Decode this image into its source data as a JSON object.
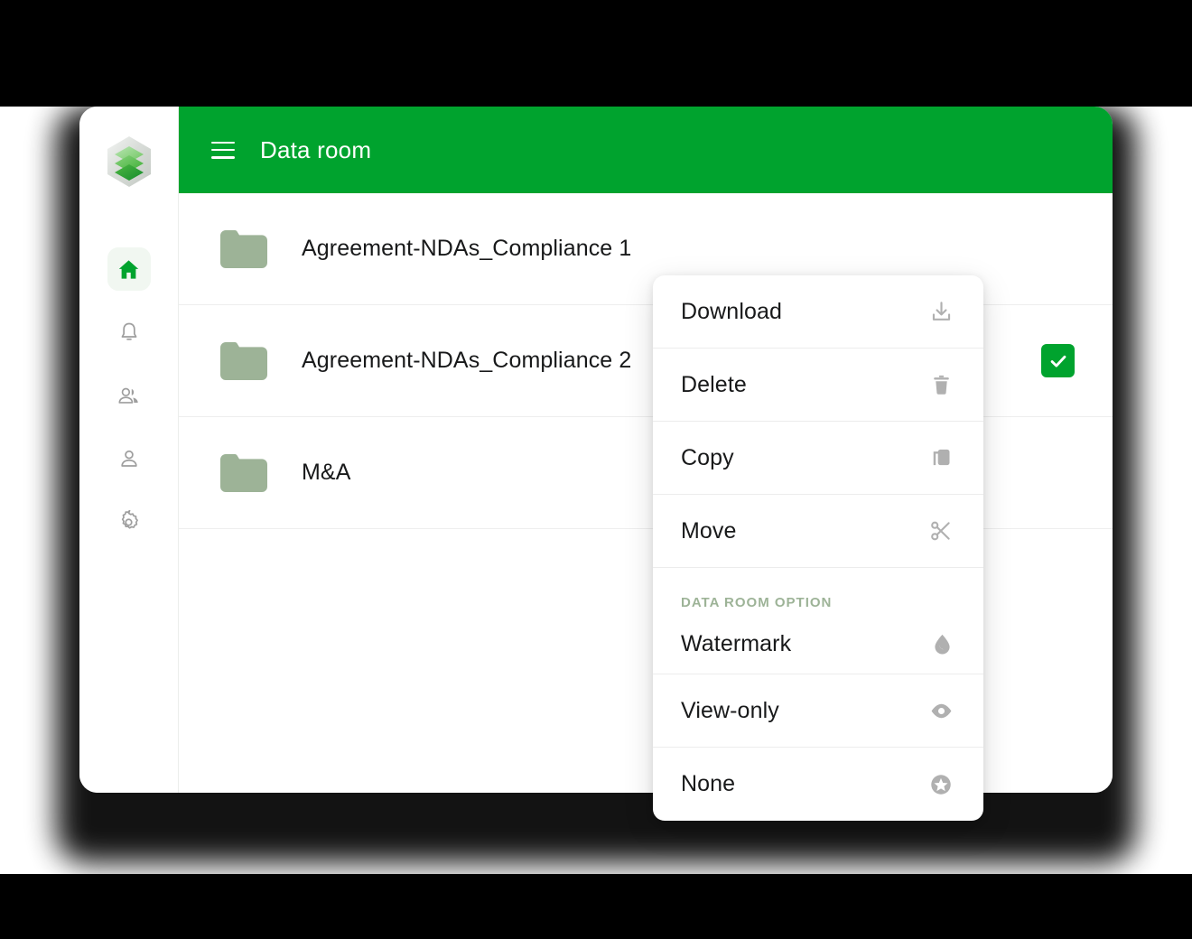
{
  "window": {
    "title": "Data room",
    "brand_icon": "stacked-layers-logo",
    "accent_color": "#00a32e",
    "folder_color": "#9db397",
    "section_label_color": "#9db397"
  },
  "topbar": {
    "menu_icon": "hamburger-icon",
    "title": "Data room"
  },
  "sidebar": {
    "items": [
      {
        "icon": "home-icon",
        "name": "home",
        "active": true
      },
      {
        "icon": "bell-icon",
        "name": "notifications",
        "active": false
      },
      {
        "icon": "group-icon",
        "name": "teams",
        "active": false
      },
      {
        "icon": "person-icon",
        "name": "profile",
        "active": false
      },
      {
        "icon": "gear-icon",
        "name": "settings",
        "active": false
      }
    ]
  },
  "file_list": {
    "rows": [
      {
        "name": "Agreement-NDAs_Compliance 1",
        "icon": "folder-icon",
        "selected": false
      },
      {
        "name": "Agreement-NDAs_Compliance 2",
        "icon": "folder-icon",
        "selected": true
      },
      {
        "name": "M&A",
        "icon": "folder-icon",
        "selected": false
      }
    ]
  },
  "context_menu": {
    "items": [
      {
        "label": "Download",
        "icon": "download-icon"
      },
      {
        "label": "Delete",
        "icon": "trash-icon"
      },
      {
        "label": "Copy",
        "icon": "copy-icon"
      },
      {
        "label": "Move",
        "icon": "scissors-icon"
      }
    ],
    "section": {
      "title": "DATA ROOM OPTION",
      "items": [
        {
          "label": "Watermark",
          "icon": "droplet-icon"
        },
        {
          "label": "View-only",
          "icon": "eye-icon"
        },
        {
          "label": "None",
          "icon": "star-circle-icon"
        }
      ]
    }
  }
}
